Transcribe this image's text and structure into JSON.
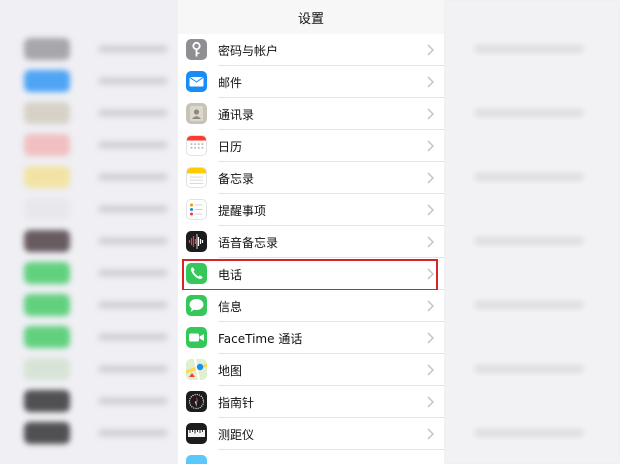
{
  "header": {
    "title": "设置"
  },
  "rows": [
    {
      "label": "密码与帐户",
      "icon": "key-icon",
      "color": "#8e8e93"
    },
    {
      "label": "邮件",
      "icon": "mail-icon",
      "color": "#1a8cf5"
    },
    {
      "label": "通讯录",
      "icon": "contacts-icon",
      "color": "#c8c3b8"
    },
    {
      "label": "日历",
      "icon": "calendar-icon",
      "color": "#ffffff"
    },
    {
      "label": "备忘录",
      "icon": "notes-icon",
      "color": "#ffffff"
    },
    {
      "label": "提醒事项",
      "icon": "reminders-icon",
      "color": "#ffffff"
    },
    {
      "label": "语音备忘录",
      "icon": "voice-memos-icon",
      "color": "#1c1c1e"
    },
    {
      "label": "电话",
      "icon": "phone-icon",
      "color": "#34c759"
    },
    {
      "label": "信息",
      "icon": "messages-icon",
      "color": "#34c759"
    },
    {
      "label": "FaceTime 通话",
      "icon": "facetime-icon",
      "color": "#34c759"
    },
    {
      "label": "地图",
      "icon": "maps-icon",
      "color": "#e8f0e0"
    },
    {
      "label": "指南针",
      "icon": "compass-icon",
      "color": "#1c1c1e"
    },
    {
      "label": "测距仪",
      "icon": "measure-icon",
      "color": "#1c1c1e"
    }
  ],
  "highlight_color": "#d9222a"
}
